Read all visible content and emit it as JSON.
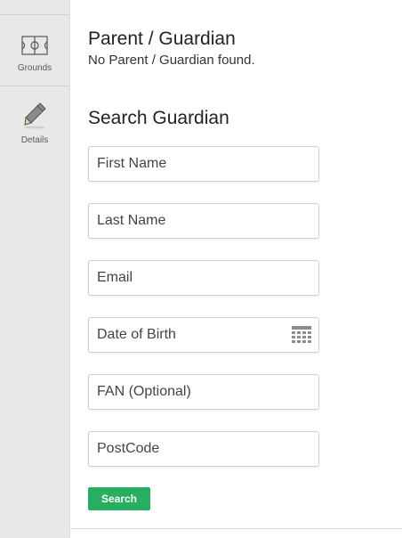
{
  "sidebar": {
    "items": [
      {
        "label": "Grounds",
        "icon": "field-pitch-icon"
      },
      {
        "label": "Details",
        "icon": "pencil-icon"
      }
    ]
  },
  "parent": {
    "title": "Parent / Guardian",
    "empty_message": "No Parent / Guardian found."
  },
  "search": {
    "title": "Search Guardian",
    "fields": {
      "first_name": "First Name",
      "last_name": "Last Name",
      "email": "Email",
      "dob": "Date of Birth",
      "fan": "FAN (Optional)",
      "postcode": "PostCode"
    },
    "button_label": "Search"
  },
  "colors": {
    "accent": "#27ae60",
    "sidebar_bg": "#e8e8e8"
  }
}
